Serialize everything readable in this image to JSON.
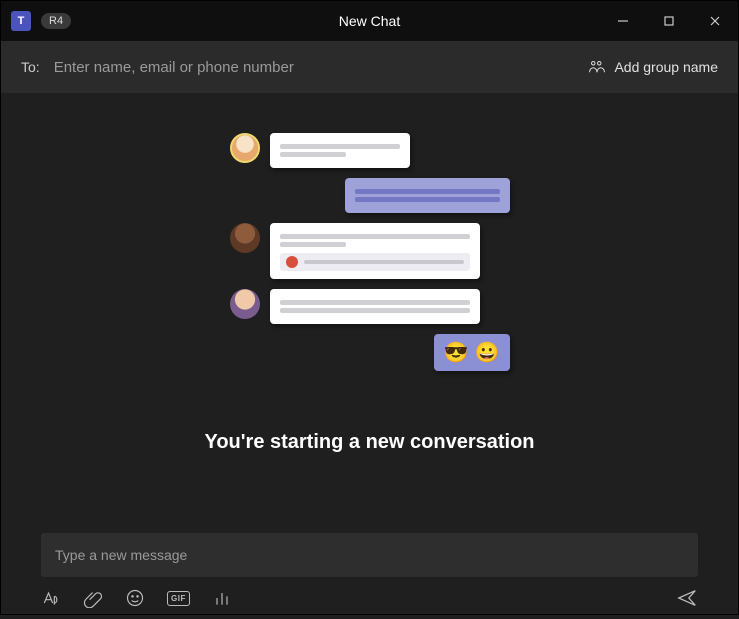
{
  "titlebar": {
    "logo_letter": "T",
    "badge": "R4",
    "title": "New Chat"
  },
  "to_bar": {
    "label": "To:",
    "placeholder": "Enter name, email or phone number",
    "add_group": "Add group name"
  },
  "main": {
    "headline": "You're starting a new conversation",
    "emoji_cool": "😎",
    "emoji_smile": "😀"
  },
  "compose": {
    "placeholder": "Type a new message",
    "gif_label": "GIF"
  }
}
